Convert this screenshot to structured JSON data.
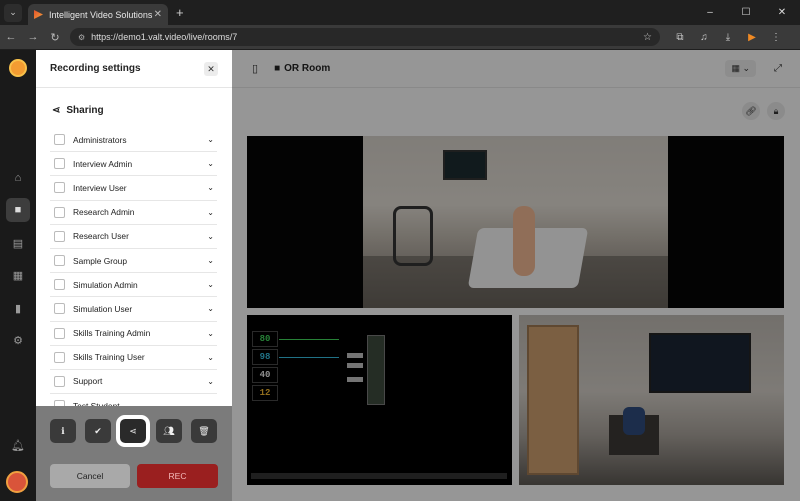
{
  "browser": {
    "tab_title": "Intelligent Video Solutions",
    "tab_close": "✕",
    "new_tab": "+",
    "url": "https://demo1.valt.video/live/rooms/7",
    "window_controls": [
      "–",
      "☐",
      "✕"
    ]
  },
  "room": {
    "name": "OR Room"
  },
  "settings": {
    "title": "Recording settings",
    "section": "Sharing",
    "groups": [
      "Administrators",
      "Interview Admin",
      "Interview User",
      "Research Admin",
      "Research User",
      "Sample Group",
      "Simulation Admin",
      "Simulation User",
      "Skills Training Admin",
      "Skills Training User",
      "Support",
      "Test Student"
    ]
  },
  "footer": {
    "cancel_label": "Cancel",
    "rec_label": "REC"
  },
  "vitals": {
    "values": [
      "80",
      "98",
      "40",
      "12"
    ],
    "colors": [
      "#3fd05a",
      "#35b8d8",
      "#e8e8e8",
      "#e8b030"
    ]
  },
  "colors": {
    "rec_button": "#9a1f1f",
    "brand_orange": "#f39c32"
  }
}
